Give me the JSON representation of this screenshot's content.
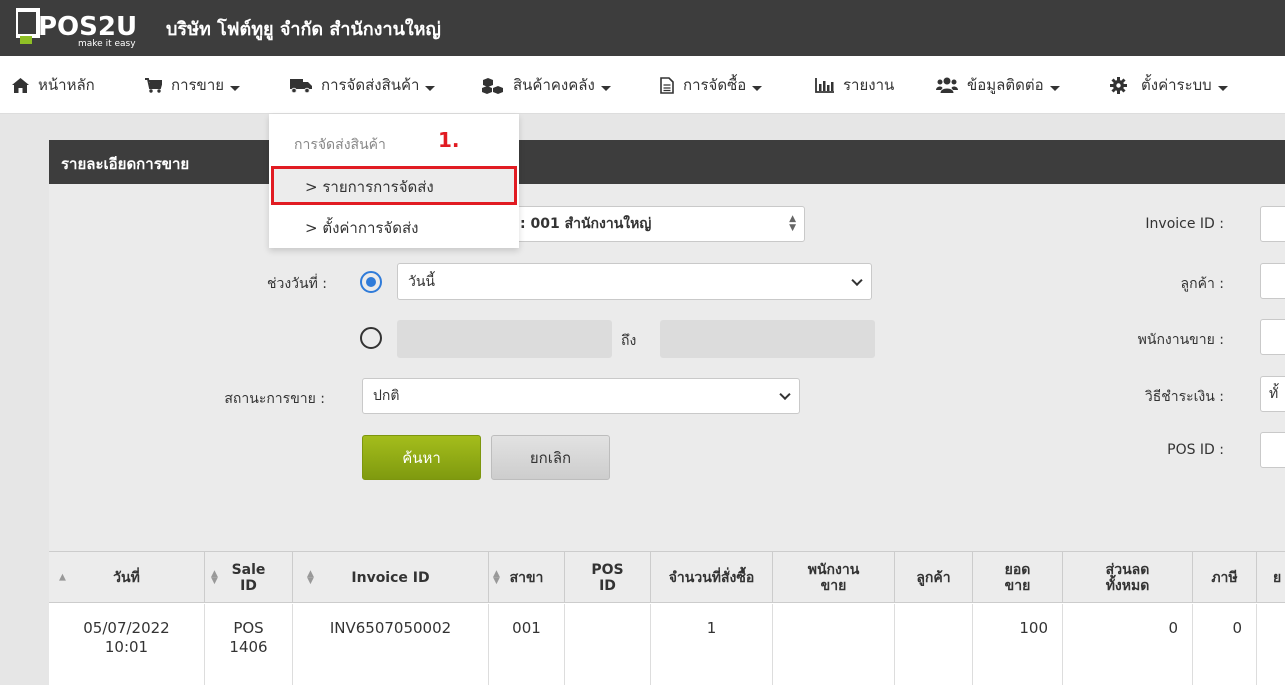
{
  "header": {
    "logo_text": "POS2U",
    "logo_tagline": "make it easy",
    "company": "บริษัท โฟต์ทูยู จำกัด สำนักงานใหญ่"
  },
  "nav": {
    "home": "หน้าหลัก",
    "sales": "การขาย",
    "delivery": "การจัดส่งสินค้า",
    "inventory": "สินค้าคงคลัง",
    "purchase": "การจัดซื้อ",
    "report": "รายงาน",
    "contacts": "ข้อมูลติดต่อ",
    "settings": "ตั้งค่าระบบ"
  },
  "dropdown": {
    "header": "การจัดส่งสินค้า",
    "step": "1.",
    "item1": "> รายการการจัดส่ง",
    "item2": "> ตั้งค่าการจัดส่ง"
  },
  "panel": {
    "title": "รายละเอียดการขาย",
    "branch_value": ": 001 สำนักงานใหญ่",
    "date_label": "ช่วงวันที่ :",
    "date_value": "วันนี้",
    "to_label": "ถึง",
    "status_label": "สถานะการขาย :",
    "status_value": "ปกติ",
    "search_btn": "ค้นหา",
    "cancel_btn": "ยกเลิก",
    "invoice_label": "Invoice ID :",
    "customer_label": "ลูกค้า :",
    "seller_label": "พนักงานขาย :",
    "payment_label": "วิธีชำระเงิน :",
    "payment_value_partial": "ทั้",
    "posid_label": "POS ID :"
  },
  "table": {
    "headers": [
      "วันที่",
      "Sale ID",
      "Invoice ID",
      "สาขา",
      "POS ID",
      "จำนวนที่สั่งซื้อ",
      "พนักงานขาย",
      "ลูกค้า",
      "ยอดขาย",
      "ส่วนลดทั้งหมด",
      "ภาษี",
      "ย"
    ],
    "rows": [
      {
        "date": "05/07/2022",
        "time": "10:01",
        "sale_id_1": "POS",
        "sale_id_2": "1406",
        "invoice_id": "INV6507050002",
        "branch": "001",
        "pos_id": "",
        "qty": "1",
        "seller": "",
        "customer": "",
        "sales_total": "100",
        "discount": "0",
        "tax": "0"
      }
    ]
  },
  "colors": {
    "topbar": "#3d3d3d",
    "highlight_red": "#e11b22",
    "search_green": "#8fa915",
    "radio_blue": "#2f7bd9"
  }
}
